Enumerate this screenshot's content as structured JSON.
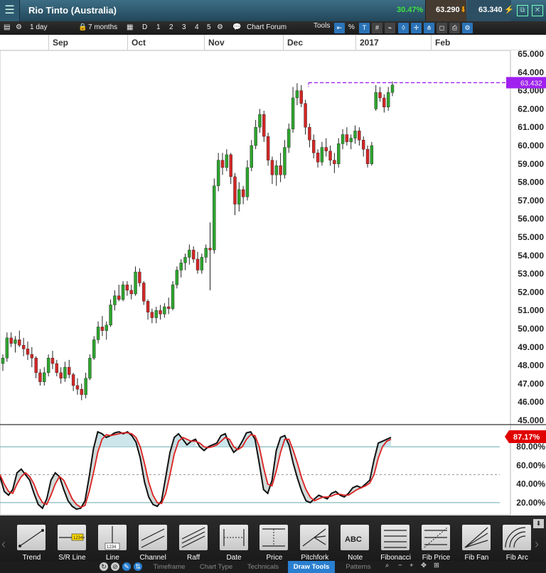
{
  "header": {
    "menu_icon": "hamburger-icon",
    "title": "Rio Tinto (Australia)",
    "search_icon": "search-icon",
    "change_pct": "30.47%",
    "sell_price": "63.290",
    "buy_price": "63.340"
  },
  "toolbar": {
    "interval": "1 day",
    "range": "7 months",
    "periods": [
      "D",
      "1",
      "2",
      "3",
      "4",
      "5"
    ],
    "chart_forum": "Chart Forum",
    "tools": "Tools",
    "percent": "%"
  },
  "months": [
    "Sep",
    "Oct",
    "Nov",
    "Dec",
    "2017",
    "Feb"
  ],
  "price_axis": [
    "65.000",
    "64.000",
    "63.000",
    "62.000",
    "61.000",
    "60.000",
    "59.000",
    "58.000",
    "57.000",
    "56.000",
    "55.000",
    "54.000",
    "53.000",
    "52.000",
    "51.000",
    "50.000",
    "49.000",
    "48.000",
    "47.000",
    "46.000",
    "45.000"
  ],
  "current_price_label": "63.432",
  "stoch_axis": [
    "80.00%",
    "60.00%",
    "40.00%",
    "20.00%"
  ],
  "stoch_current_label": "87.17%",
  "colors": {
    "up": "#2ea42e",
    "down": "#d32626",
    "price_line": "#a020f0",
    "stoch_k": "#111111",
    "stoch_d": "#dd2020",
    "stoch_label": "#e00000"
  },
  "chart_data": {
    "type": "candlestick",
    "x_label": "",
    "y_range": [
      45,
      65
    ],
    "candles": [
      [
        48.1,
        48.6,
        47.7,
        48.4
      ],
      [
        48.4,
        49.8,
        48.2,
        49.5
      ],
      [
        49.5,
        49.8,
        49.0,
        49.2
      ],
      [
        49.2,
        49.6,
        48.7,
        49.4
      ],
      [
        49.4,
        49.9,
        49.0,
        49.1
      ],
      [
        49.1,
        49.5,
        48.5,
        48.9
      ],
      [
        48.9,
        49.3,
        48.3,
        48.6
      ],
      [
        48.6,
        49.0,
        47.9,
        48.4
      ],
      [
        48.4,
        48.5,
        47.3,
        47.6
      ],
      [
        47.6,
        47.8,
        46.9,
        47.1
      ],
      [
        47.1,
        47.9,
        46.9,
        47.6
      ],
      [
        47.6,
        48.6,
        47.4,
        48.4
      ],
      [
        48.4,
        48.8,
        47.8,
        48.1
      ],
      [
        48.1,
        48.3,
        47.4,
        47.6
      ],
      [
        47.6,
        47.9,
        47.0,
        47.3
      ],
      [
        47.3,
        48.2,
        47.1,
        47.9
      ],
      [
        47.9,
        48.3,
        47.3,
        47.5
      ],
      [
        47.5,
        47.6,
        46.6,
        46.9
      ],
      [
        46.9,
        47.3,
        46.4,
        46.7
      ],
      [
        46.7,
        47.0,
        46.1,
        46.4
      ],
      [
        46.4,
        47.6,
        46.2,
        47.3
      ],
      [
        47.3,
        48.6,
        47.2,
        48.4
      ],
      [
        48.4,
        49.6,
        48.3,
        49.4
      ],
      [
        49.4,
        50.4,
        49.2,
        50.1
      ],
      [
        50.1,
        50.7,
        49.6,
        49.9
      ],
      [
        49.9,
        50.4,
        49.4,
        50.2
      ],
      [
        50.2,
        51.6,
        50.1,
        51.3
      ],
      [
        51.3,
        52.1,
        51.0,
        51.8
      ],
      [
        51.8,
        52.4,
        51.5,
        51.6
      ],
      [
        51.6,
        52.6,
        51.5,
        52.4
      ],
      [
        52.4,
        52.6,
        51.8,
        52.1
      ],
      [
        52.1,
        52.4,
        51.6,
        51.9
      ],
      [
        51.9,
        53.4,
        51.8,
        53.1
      ],
      [
        53.1,
        53.3,
        52.3,
        52.5
      ],
      [
        52.5,
        52.6,
        51.3,
        51.5
      ],
      [
        51.5,
        51.6,
        50.5,
        50.9
      ],
      [
        50.9,
        51.1,
        50.3,
        50.6
      ],
      [
        50.6,
        51.2,
        50.3,
        51.0
      ],
      [
        51.0,
        51.3,
        50.5,
        50.8
      ],
      [
        50.8,
        51.4,
        50.6,
        51.2
      ],
      [
        51.2,
        51.7,
        50.8,
        51.1
      ],
      [
        51.1,
        52.6,
        51.0,
        52.4
      ],
      [
        52.4,
        53.4,
        52.2,
        53.2
      ],
      [
        53.2,
        53.8,
        52.8,
        53.6
      ],
      [
        53.6,
        54.1,
        53.2,
        53.9
      ],
      [
        53.9,
        54.6,
        53.5,
        54.3
      ],
      [
        54.3,
        54.5,
        53.6,
        53.8
      ],
      [
        53.8,
        54.2,
        53.0,
        53.2
      ],
      [
        53.2,
        54.1,
        53.0,
        53.9
      ],
      [
        53.9,
        54.6,
        53.6,
        54.4
      ],
      [
        54.4,
        55.8,
        52.1,
        54.3
      ],
      [
        54.3,
        58.2,
        54.1,
        57.8
      ],
      [
        57.8,
        59.6,
        57.5,
        59.2
      ],
      [
        59.2,
        59.6,
        58.4,
        58.8
      ],
      [
        58.8,
        59.8,
        58.6,
        59.5
      ],
      [
        59.5,
        59.6,
        57.9,
        58.3
      ],
      [
        58.3,
        58.5,
        56.2,
        56.8
      ],
      [
        56.8,
        58.0,
        56.4,
        57.6
      ],
      [
        57.6,
        57.8,
        56.8,
        57.2
      ],
      [
        57.2,
        59.2,
        57.0,
        58.8
      ],
      [
        58.8,
        60.3,
        58.6,
        60.0
      ],
      [
        60.0,
        61.4,
        59.8,
        61.0
      ],
      [
        61.0,
        62.0,
        60.7,
        61.7
      ],
      [
        61.7,
        61.9,
        60.2,
        60.5
      ],
      [
        60.5,
        60.7,
        58.9,
        59.2
      ],
      [
        59.2,
        59.4,
        57.9,
        58.4
      ],
      [
        58.4,
        59.2,
        57.8,
        58.9
      ],
      [
        58.9,
        59.6,
        58.0,
        58.4
      ],
      [
        58.4,
        60.3,
        58.2,
        59.9
      ],
      [
        59.9,
        61.2,
        59.6,
        60.9
      ],
      [
        60.9,
        63.2,
        60.7,
        62.6
      ],
      [
        62.6,
        63.4,
        62.2,
        63.0
      ],
      [
        63.0,
        63.3,
        62.1,
        62.3
      ],
      [
        62.3,
        62.5,
        60.6,
        61.0
      ],
      [
        61.0,
        61.2,
        59.9,
        60.3
      ],
      [
        60.3,
        60.6,
        59.3,
        59.6
      ],
      [
        59.6,
        59.8,
        58.8,
        59.1
      ],
      [
        59.1,
        60.2,
        58.9,
        59.9
      ],
      [
        59.9,
        60.4,
        59.4,
        59.7
      ],
      [
        59.7,
        60.0,
        58.9,
        59.2
      ],
      [
        59.2,
        59.6,
        58.5,
        59.0
      ],
      [
        59.0,
        60.4,
        58.8,
        60.1
      ],
      [
        60.1,
        60.9,
        59.8,
        60.6
      ],
      [
        60.6,
        61.0,
        60.0,
        60.2
      ],
      [
        60.2,
        60.6,
        59.8,
        60.4
      ],
      [
        60.4,
        61.1,
        60.1,
        60.8
      ],
      [
        60.8,
        61.0,
        60.0,
        60.3
      ],
      [
        60.3,
        60.5,
        59.4,
        59.8
      ],
      [
        59.8,
        60.0,
        58.8,
        59.0
      ],
      [
        59.0,
        60.2,
        58.9,
        60.0
      ],
      [
        62.0,
        63.3,
        61.9,
        62.9
      ],
      [
        62.9,
        63.2,
        62.4,
        62.6
      ],
      [
        62.6,
        62.8,
        61.8,
        62.1
      ],
      [
        62.1,
        63.2,
        61.9,
        62.9
      ],
      [
        62.9,
        63.5,
        62.7,
        63.3
      ]
    ],
    "stochastic": {
      "k": [
        48,
        32,
        28,
        34,
        52,
        56,
        50,
        44,
        30,
        18,
        14,
        24,
        44,
        52,
        48,
        34,
        22,
        16,
        13,
        14,
        22,
        48,
        78,
        96,
        94,
        90,
        92,
        95,
        96,
        94,
        96,
        92,
        85,
        68,
        42,
        26,
        18,
        16,
        22,
        48,
        74,
        90,
        94,
        88,
        82,
        86,
        88,
        80,
        76,
        80,
        82,
        84,
        92,
        94,
        82,
        74,
        78,
        86,
        95,
        96,
        88,
        62,
        34,
        30,
        44,
        76,
        90,
        92,
        82,
        62,
        46,
        32,
        22,
        20,
        24,
        28,
        26,
        24,
        30,
        32,
        28,
        26,
        30,
        36,
        38,
        36,
        40,
        44,
        66,
        84,
        86,
        88,
        90
      ],
      "d": [
        50,
        40,
        32,
        30,
        40,
        48,
        52,
        48,
        40,
        28,
        20,
        18,
        28,
        40,
        48,
        44,
        34,
        24,
        18,
        15,
        17,
        32,
        52,
        74,
        88,
        93,
        92,
        93,
        94,
        95,
        95,
        94,
        90,
        80,
        62,
        42,
        28,
        20,
        19,
        30,
        50,
        72,
        86,
        90,
        88,
        86,
        86,
        84,
        80,
        79,
        80,
        82,
        86,
        90,
        88,
        80,
        77,
        80,
        88,
        93,
        92,
        80,
        58,
        40,
        38,
        54,
        74,
        88,
        88,
        76,
        62,
        46,
        34,
        26,
        22,
        24,
        26,
        26,
        27,
        29,
        29,
        28,
        28,
        31,
        34,
        36,
        38,
        41,
        50,
        68,
        80,
        86,
        88
      ],
      "upper": 80,
      "middle": 50,
      "lower": 20,
      "y_range": [
        10,
        100
      ]
    }
  },
  "draw_tools": [
    {
      "label": "Trend",
      "icon": "trend-line-icon"
    },
    {
      "label": "S/R Line",
      "icon": "sr-line-icon"
    },
    {
      "label": "Line",
      "icon": "vertical-line-icon"
    },
    {
      "label": "Channel",
      "icon": "channel-icon"
    },
    {
      "label": "Raff",
      "icon": "raff-channel-icon"
    },
    {
      "label": "Date",
      "icon": "date-range-icon"
    },
    {
      "label": "Price",
      "icon": "price-range-icon"
    },
    {
      "label": "Pitchfork",
      "icon": "pitchfork-icon"
    },
    {
      "label": "Note",
      "icon": "note-icon",
      "glyph": "ABC"
    },
    {
      "label": "Fibonacci",
      "icon": "fibonacci-icon"
    },
    {
      "label": "Fib Price",
      "icon": "fib-price-icon"
    },
    {
      "label": "Fib Fan",
      "icon": "fib-fan-icon"
    },
    {
      "label": "Fib Arc",
      "icon": "fib-arc-icon"
    }
  ],
  "sr_line_badge": "1234",
  "line_badge": "1234",
  "bottom_tabs": [
    "Timeframe",
    "Chart Type",
    "Technicals",
    "Draw Tools",
    "Patterns"
  ],
  "active_tab": "Draw Tools"
}
